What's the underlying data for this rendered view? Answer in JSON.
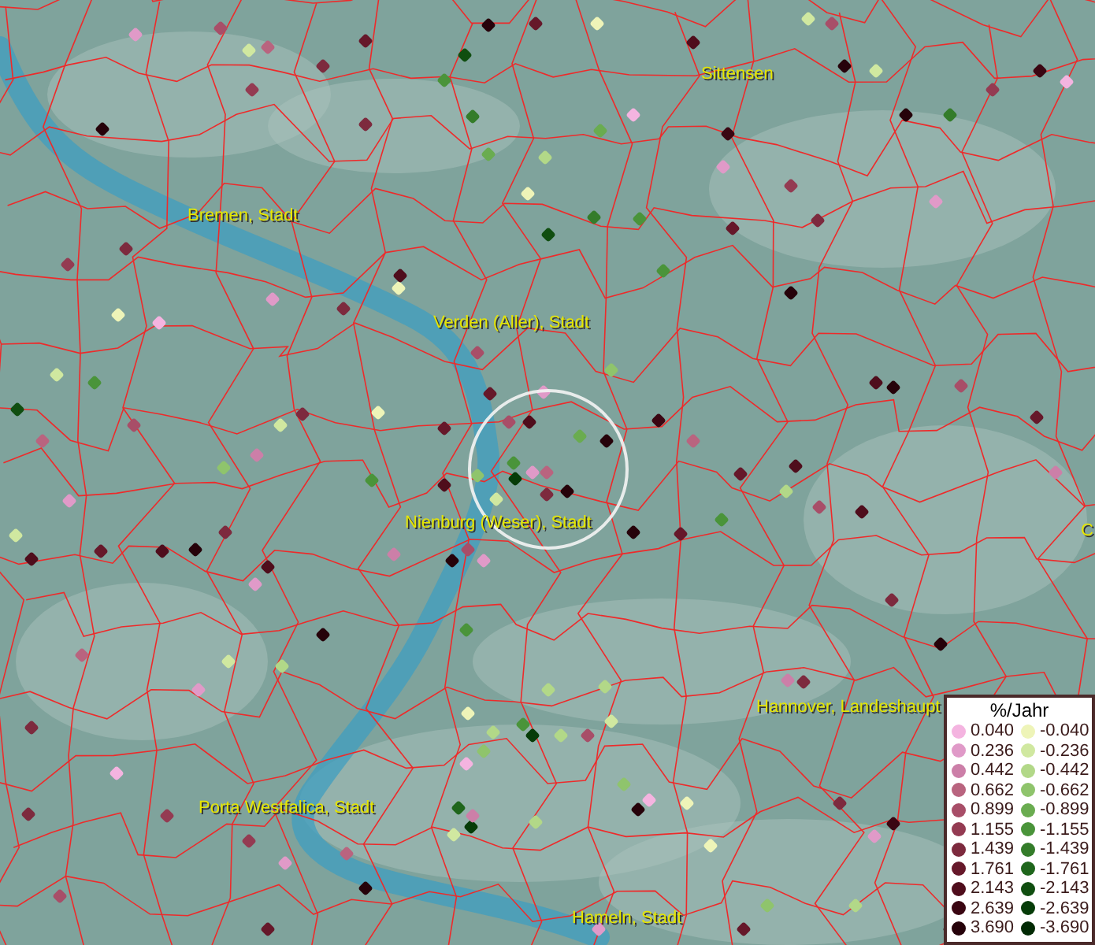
{
  "map": {
    "place_labels": [
      {
        "text": "Sittensen"
      },
      {
        "text": "Bremen, Stadt"
      },
      {
        "text": "Verden (Aller), Stadt"
      },
      {
        "text": "Nienburg (Weser), Stadt"
      },
      {
        "text": "Hannover, Landeshaupt"
      },
      {
        "text": "Porta Westfalica, Stadt"
      },
      {
        "text": "Hameln, Stadt"
      },
      {
        "text": "C"
      }
    ]
  },
  "legend": {
    "title": "%/Jahr",
    "entries": [
      {
        "label": "0.040",
        "color": "#f4b4e0"
      },
      {
        "label": "-0.040",
        "color": "#eef4b8"
      },
      {
        "label": "0.236",
        "color": "#e09ac8"
      },
      {
        "label": "-0.236",
        "color": "#d0e8a0"
      },
      {
        "label": "0.442",
        "color": "#cc7fa8"
      },
      {
        "label": "-0.442",
        "color": "#b2d888"
      },
      {
        "label": "0.662",
        "color": "#b9647f"
      },
      {
        "label": "-0.662",
        "color": "#8fc46c"
      },
      {
        "label": "0.899",
        "color": "#a84e68"
      },
      {
        "label": "-0.899",
        "color": "#6aac50"
      },
      {
        "label": "1.155",
        "color": "#943b52"
      },
      {
        "label": "-1.155",
        "color": "#4a943a"
      },
      {
        "label": "1.439",
        "color": "#7d2a3e"
      },
      {
        "label": "-1.439",
        "color": "#347c2a"
      },
      {
        "label": "1.761",
        "color": "#66182a"
      },
      {
        "label": "-1.761",
        "color": "#1f661c"
      },
      {
        "label": "2.143",
        "color": "#4f0d1c"
      },
      {
        "label": "-2.143",
        "color": "#104e10"
      },
      {
        "label": "2.639",
        "color": "#3a0612"
      },
      {
        "label": "-2.639",
        "color": "#063c08"
      },
      {
        "label": "3.690",
        "color": "#26020a"
      },
      {
        "label": "-3.690",
        "color": "#022a04"
      }
    ]
  }
}
